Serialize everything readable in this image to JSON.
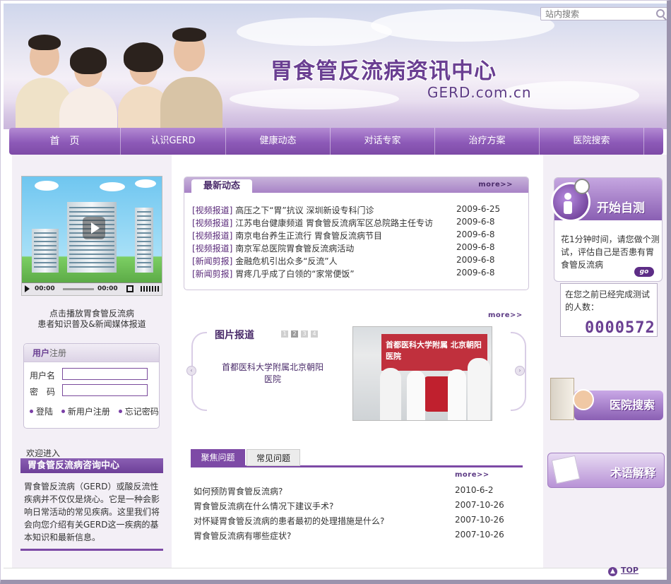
{
  "header": {
    "search_placeholder": "站内搜索",
    "site_title": "胃食管反流病资讯中心",
    "domain_text": "GERD.com.cn"
  },
  "nav": {
    "items": [
      {
        "label": "首　页"
      },
      {
        "label": "认识GERD"
      },
      {
        "label": "健康动态"
      },
      {
        "label": "对话专家"
      },
      {
        "label": "治疗方案"
      },
      {
        "label": "医院搜索"
      }
    ]
  },
  "video": {
    "time_current": "00:00",
    "time_total": "00:00",
    "caption_line1": "点击播放胃食管反流病",
    "caption_line2": "患者知识普及&新闻媒体报道"
  },
  "login": {
    "title_bold": "用户",
    "title_rest": "注册",
    "username_label": "用户名",
    "password_label": "密　码",
    "login_link": "登陆",
    "register_link": "新用户注册",
    "forgot_link": "忘记密码"
  },
  "welcome": {
    "enter_text": "欢迎进入",
    "box_title": "胃食管反流病咨询中心",
    "description": "胃食管反流病（GERD）或酸反流性疾病并不仅仅是烧心。它是一种会影响日常活动的常见疾病。这里我们将会向您介绍有关GERD这一疾病的基本知识和最新信息。"
  },
  "news": {
    "tab_label": "最新动态",
    "more": "more>>",
    "items": [
      {
        "cat": "[视频报道]",
        "title": "高压之下“胃”抗议 深圳新设专科门诊",
        "date": "2009-6-25"
      },
      {
        "cat": "[视频报道]",
        "title": "江苏电台健康频道 胃食管反流病军区总院路主任专访",
        "date": "2009-6-8"
      },
      {
        "cat": "[视频报道]",
        "title": "南京电台养生正流行 胃食管反流病节目",
        "date": "2009-6-8"
      },
      {
        "cat": "[视频报道]",
        "title": "南京军总医院胃食管反流病活动",
        "date": "2009-6-8"
      },
      {
        "cat": "[新闻剪报]",
        "title": "金融危机引出众多“反流”人",
        "date": "2009-6-8"
      },
      {
        "cat": "[新闻剪报]",
        "title": "胃疼几乎成了白领的“家常便饭”",
        "date": "2009-6-8"
      }
    ]
  },
  "photo_report": {
    "more": "more>>",
    "title": "图片报道",
    "pages": [
      "1",
      "2",
      "3",
      "4"
    ],
    "active_page": "2",
    "caption": "首都医科大学附属北京朝阳医院",
    "photo_banner": "首都医科大学附属 北京朝阳医院",
    "prev_arrow": "‹",
    "next_arrow": "›"
  },
  "faq": {
    "tabs": [
      {
        "label": "聚焦问题"
      },
      {
        "label": "常见问题"
      }
    ],
    "more": "more>>",
    "items": [
      {
        "title": "如何预防胃食管反流病?",
        "date": "2010-6-2"
      },
      {
        "title": "胃食管反流病在什么情况下建议手术?",
        "date": "2007-10-26"
      },
      {
        "title": "对怀疑胃食管反流病的患者最初的处理措施是什么?",
        "date": "2007-10-26"
      },
      {
        "title": "胃食管反流病有哪些症状?",
        "date": "2007-10-26"
      }
    ]
  },
  "right": {
    "selftest_title": "开始自测",
    "selftest_text": "花1分钟时间，请您做个测试，评估自己是否患有胃食管反流病",
    "go_label": "go",
    "counter_text": "在您之前已经完成测试的人数：",
    "counter_value": "0000572",
    "hospital_search": "医院搜索",
    "terms": "术语解释"
  },
  "footer": {
    "top_label": "TOP",
    "top_icon": "▲"
  },
  "colors": {
    "accent": "#7d4aa6",
    "title": "#6a3f92"
  }
}
